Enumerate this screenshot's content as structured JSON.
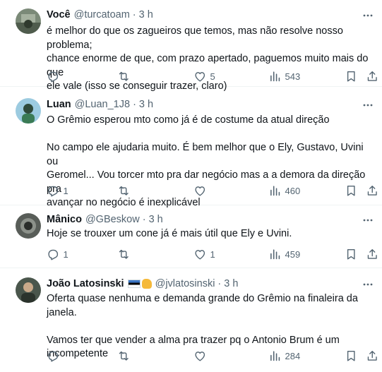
{
  "tweets": [
    {
      "name": "Você",
      "handle": "@turcatoam",
      "separator": "·",
      "time": "3 h",
      "text": "é melhor do que os zagueiros que temos, mas não resolve nosso problema;\nchance enorme de que, com prazo apertado, paguemos muito mais do que\nele vale (isso se conseguir trazer, claro)",
      "replies": "",
      "retweets": "",
      "likes": "5",
      "views": "543",
      "avatar_color": "#5b6d59"
    },
    {
      "name": "Luan",
      "handle": "@Luan_1J8",
      "separator": "·",
      "time": "3 h",
      "text": "O Grêmio esperou mto como já é de costume da atual direção\n\nNo campo ele ajudaria muito. É bem melhor que o Ely, Gustavo, Uvini ou\nGeromel... Vou torcer mto pra dar negócio mas a a demora da direção pra\navançar no negócio é inexplicável",
      "replies": "1",
      "retweets": "",
      "likes": "",
      "views": "460",
      "avatar_color": "#8fc0d8"
    },
    {
      "name": "Mânico",
      "handle": "@GBeskow",
      "separator": "·",
      "time": "3 h",
      "text": "Hoje se trouxer um cone já é mais útil que Ely e Uvini.",
      "replies": "1",
      "retweets": "",
      "likes": "1",
      "views": "459",
      "avatar_color": "#6b6f6a"
    },
    {
      "name": "João Latosinski",
      "handle": "@jvlatosinski",
      "separator": "·",
      "time": "3 h",
      "text": "Oferta quase nenhuma e demanda grande do Grêmio na finaleira da janela.\n\nVamos ter que vender a alma pra trazer pq o Antonio Brum é um\nincompetente",
      "replies": "",
      "retweets": "",
      "likes": "",
      "views": "284",
      "avatar_color": "#3d4a3f"
    }
  ],
  "colors": {
    "text": "#0f1419",
    "secondary": "#536471",
    "divider": "#eff3f4"
  },
  "icons": {
    "more": "more-dots-icon",
    "reply": "reply-icon",
    "retweet": "retweet-icon",
    "like": "heart-icon",
    "views": "views-chart-icon",
    "bookmark": "bookmark-icon",
    "share": "share-icon"
  }
}
